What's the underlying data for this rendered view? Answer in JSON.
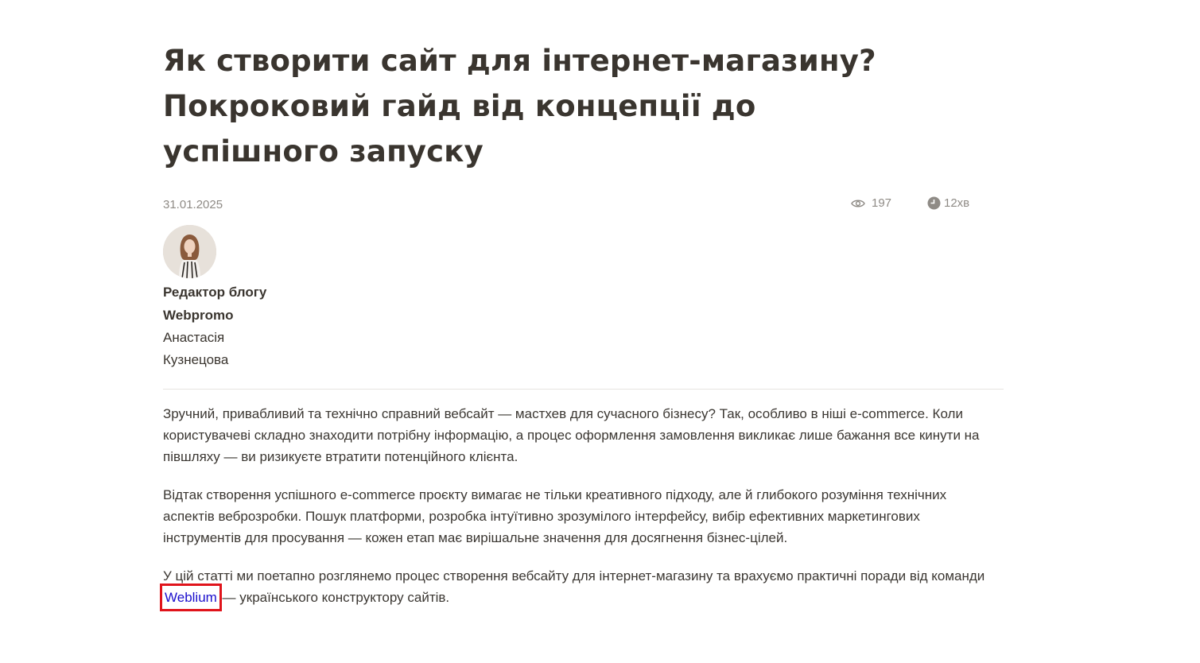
{
  "article": {
    "title_line1": "Як створити сайт для інтернет-магазину?",
    "title_line2": "Покроковий гайд від концепції до",
    "title_line3": "успішного запуску",
    "date": "31.01.2025",
    "views": "197",
    "read_time": "12хв"
  },
  "author": {
    "role_line1": "Редактор блогу",
    "role_line2": "Webpromo",
    "name_line1": "Анастасія",
    "name_line2": "Кузнецова"
  },
  "paragraphs": {
    "p1": "Зручний, привабливий та технічно справний вебсайт — мастхев для сучасного бізнесу? Так, особливо в ніші e-commerce. Коли користувачеві складно знаходити потрібну інформацію, а процес оформлення замовлення викликає лише бажання все кинути на півшляху — ви ризикуєте втратити потенційного клієнта.",
    "p2": "Відтак створення успішного e-commerce проєкту вимагає не тільки креативного підходу, але й глибокого розуміння технічних аспектів веброзробки. Пошук платформи, розробка інтуїтивно зрозумілого інтерфейсу, вибір ефективних маркетингових інструментів для просування — кожен етап має вирішальне значення для досягнення бізнес-цілей.",
    "p3_before": "У цій статті ми поетапно розглянемо процес створення вебсайту для інтернет-магазину та врахуємо практичні поради від команди ",
    "p3_link": "Weblium",
    "p3_after": " — українського конструктору сайтів."
  },
  "icons": {
    "views": "eye-icon",
    "read_time": "clock-icon"
  },
  "colors": {
    "link": "#1a0dcc",
    "highlight": "#e0141b",
    "text": "#3b3732",
    "meta": "#8f8b86"
  }
}
